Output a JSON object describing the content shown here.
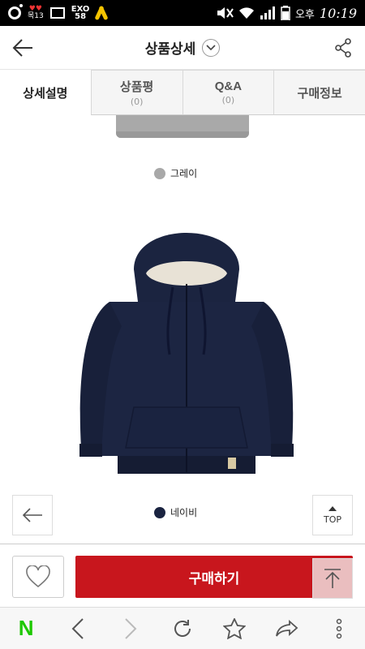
{
  "status_bar": {
    "notification_badge": "목13",
    "exo_badge": "EXO",
    "exo_count": "58",
    "ampm": "오후",
    "time": "10:19"
  },
  "header": {
    "title": "상품상세"
  },
  "tabs": [
    {
      "label": "상세설명",
      "count": ""
    },
    {
      "label": "상품평",
      "count": "(0)"
    },
    {
      "label": "Q&A",
      "count": "(0)"
    },
    {
      "label": "구매정보",
      "count": ""
    }
  ],
  "product_colors": [
    {
      "name": "그레이",
      "swatch": "#a8a8a8"
    },
    {
      "name": "네이비",
      "swatch": "#1a2340"
    }
  ],
  "top_button_label": "TOP",
  "buy_button_label": "구매하기",
  "browser_bar": {
    "home_label": "N"
  },
  "colors": {
    "buy_red": "#c8161d",
    "naver_green": "#1ec800",
    "navy": "#1a2340"
  }
}
